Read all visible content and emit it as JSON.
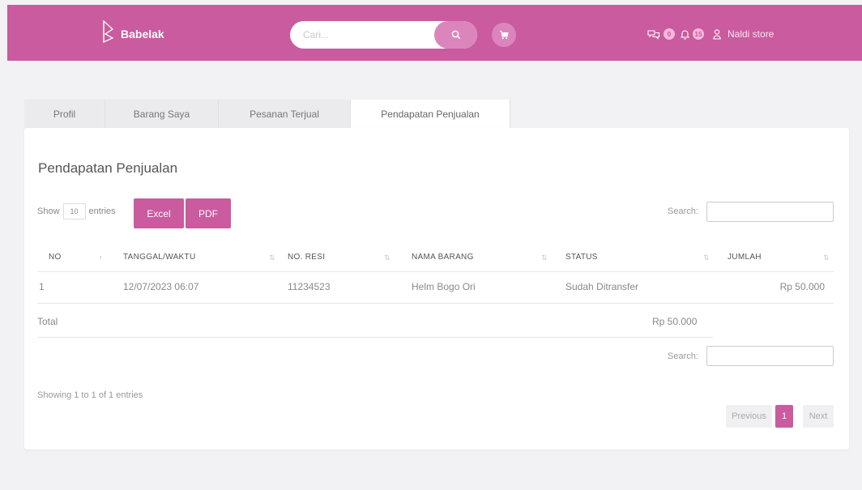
{
  "colors": {
    "brand": "#c95b9e",
    "brand_light": "#dc85bd",
    "badge": "#f6b8db"
  },
  "header": {
    "brand": "Babelak",
    "search_placeholder": "Cari...",
    "icons": [
      "logo-icon",
      "search-icon",
      "cart-icon",
      "chat-icon",
      "bell-icon",
      "user-icon"
    ],
    "chat_badge": "0",
    "notif_badge": "15",
    "user_name": "Naldi store"
  },
  "tabs": [
    "Profil",
    "Barang Saya",
    "Pesanan Terjual",
    "Pendapatan Penjualan"
  ],
  "card": {
    "title": "Pendapatan Penjualan",
    "show_label": "Show",
    "page_length": "10",
    "entries_label": "entries",
    "excel_label": "Excel",
    "pdf_label": "PDF",
    "search_label": "Search:"
  },
  "table": {
    "columns": [
      "NO",
      "TANGGAL/WAKTU",
      "NO. RESI",
      "NAMA BARANG",
      "STATUS",
      "JUMLAH"
    ],
    "sort_icon": "⇅",
    "sort_icon_active": "↑",
    "rows": [
      {
        "no": "1",
        "tanggal": "12/07/2023 06:07",
        "resi": "11234523",
        "nama": "Helm Bogo Ori",
        "status": "Sudah Ditransfer",
        "jumlah": "Rp 50.000"
      }
    ],
    "total_label": "Total",
    "total_value": "Rp 50.000"
  },
  "footer": {
    "info": "Showing 1 to 1 of 1 entries",
    "previous": "Previous",
    "page": "1",
    "next": "Next"
  }
}
